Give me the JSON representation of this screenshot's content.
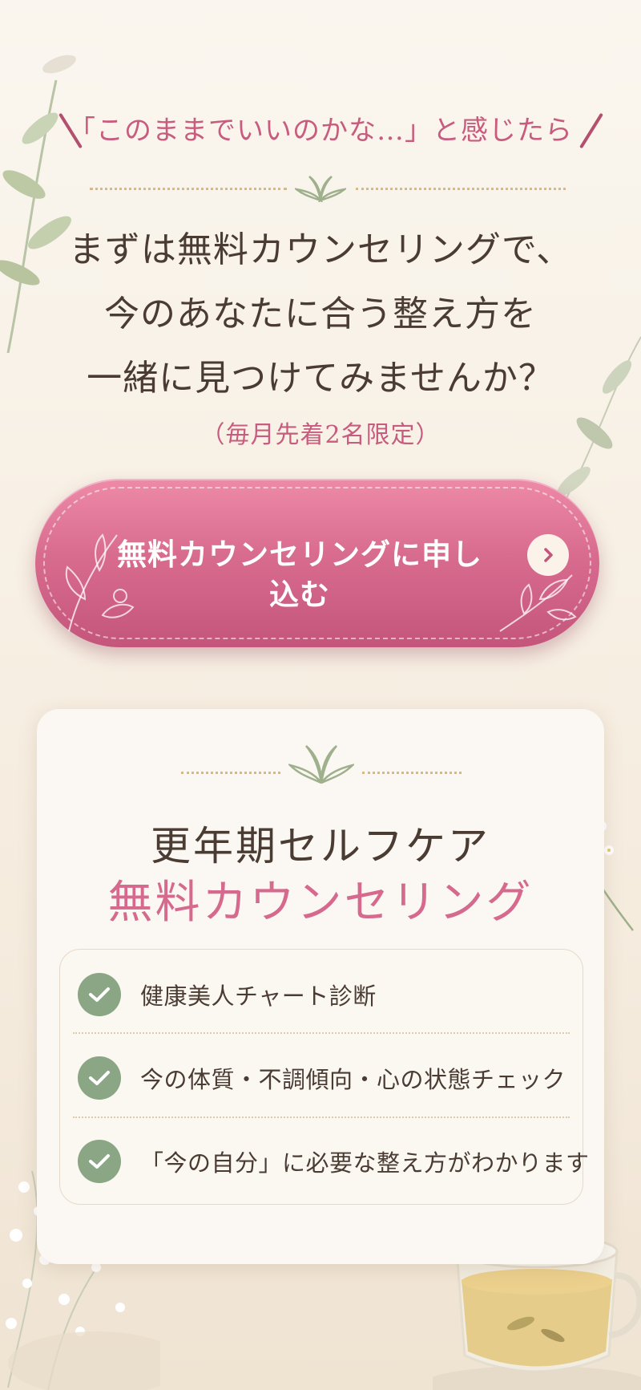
{
  "kicker": "「このままでいいのかな…」と感じたら",
  "headline": {
    "line1": "まずは無料カウンセリングで、",
    "line2": "今のあなたに合う整え方を",
    "line3": "一緒に見つけてみませんか？"
  },
  "limited_note": "（毎月先着2名限定）",
  "cta": {
    "label": "無料カウンセリングに申し込む",
    "icon": "chevron-right-icon"
  },
  "card": {
    "title_line1": "更年期セルフケア",
    "title_line2": "無料カウンセリング",
    "items": [
      {
        "text": "健康美人チャート診断"
      },
      {
        "text": "今の体質・不調傾向・心の状態チェック"
      },
      {
        "text": "「今の自分」に必要な整え方がわかります"
      }
    ]
  },
  "colors": {
    "accent_pink": "#c85c7e",
    "button_pink": "#d86c8f",
    "check_green": "#8aa684",
    "text_brown": "#4a3b33",
    "background_cream": "#f7efe3"
  }
}
